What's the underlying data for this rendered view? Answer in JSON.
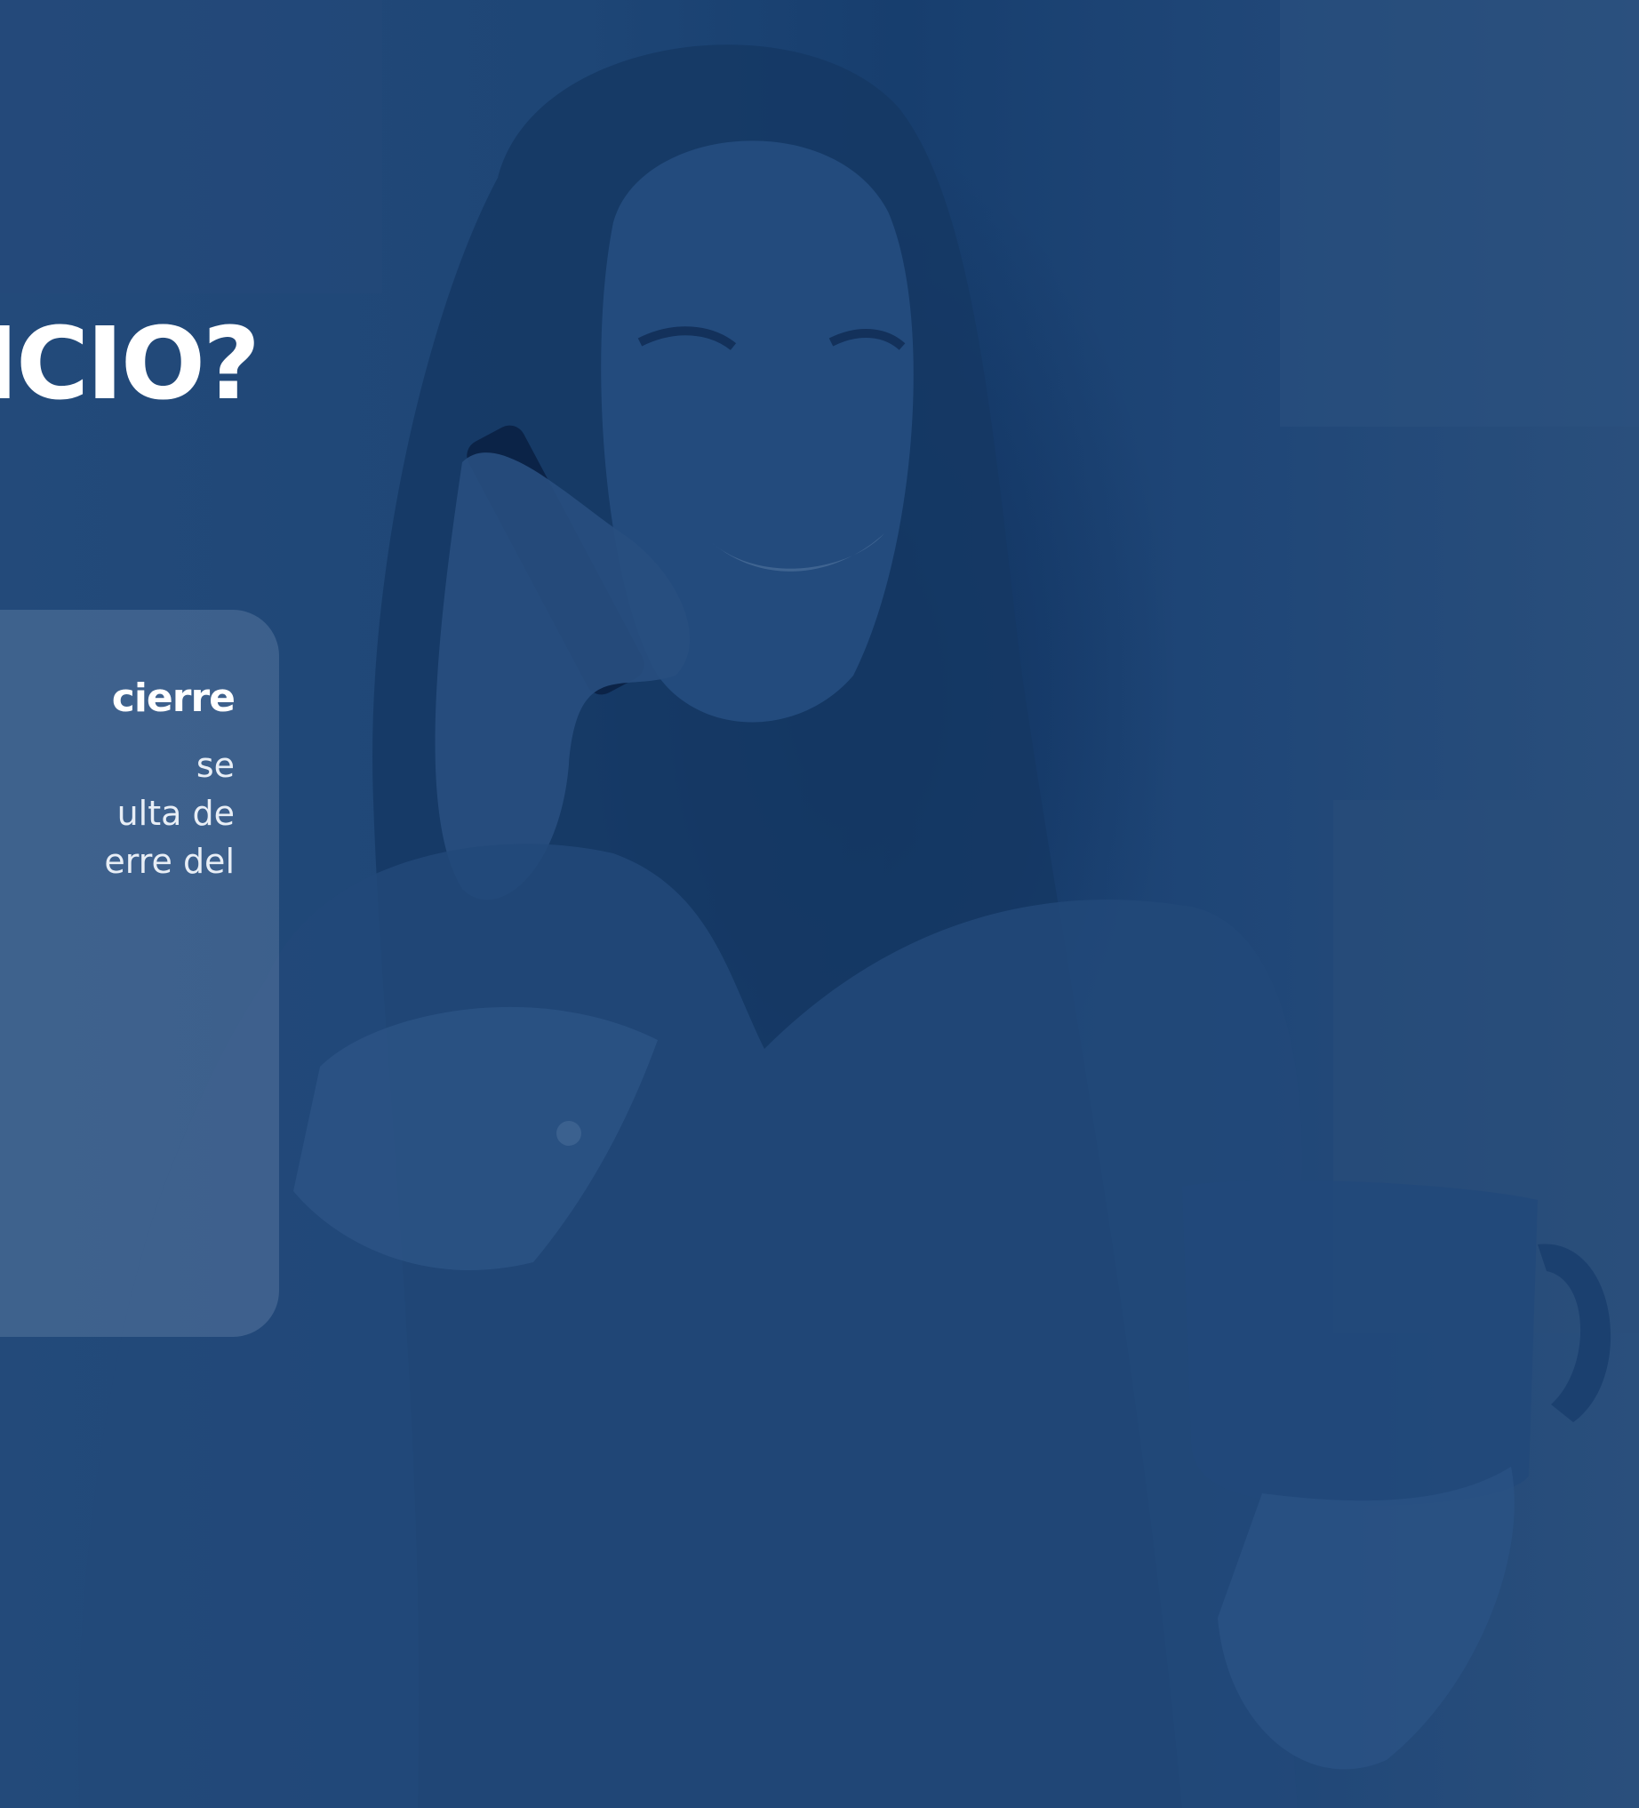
{
  "hero": {
    "heading": "ICIO?",
    "image_description": "woman-smiling-on-phone-holding-cup",
    "overlay_color": "#1f4575"
  },
  "card": {
    "title": "cierre",
    "lines": [
      "se",
      "ulta de",
      "erre del"
    ]
  }
}
